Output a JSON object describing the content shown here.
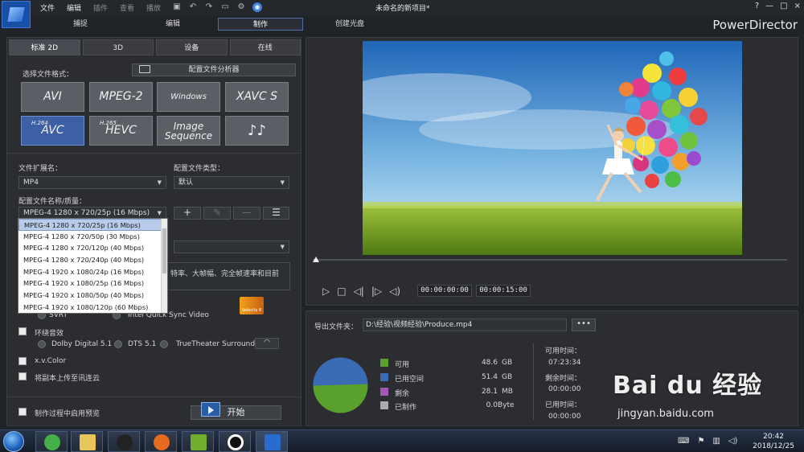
{
  "menu": {
    "items": [
      "文件",
      "编辑",
      "插件",
      "查看",
      "播放"
    ]
  },
  "title": "未命名的新项目*",
  "window_controls": [
    "?",
    "—",
    "□",
    "×"
  ],
  "modes": {
    "capture": "捕捉",
    "edit": "编辑",
    "produce": "制作",
    "disc": "创建光盘"
  },
  "brand": "PowerDirector",
  "subtabs": [
    "标准 2D",
    "3D",
    "设备",
    "在线"
  ],
  "format": {
    "label": "选择文件格式：",
    "analyzer": "配置文件分析器",
    "buttons": {
      "avi": "AVI",
      "mpeg2": "MPEG-2",
      "wmv": "Windows Media",
      "xavcs": "XAVC S",
      "avc_sup": "H.264",
      "avc": "AVC",
      "hevc_sup": "H.265",
      "hevc": "HEVC",
      "imgseq1": "Image",
      "imgseq2": "Sequence",
      "audio": "♪♪"
    }
  },
  "extension": {
    "label": "文件扩展名：",
    "value": "MP4"
  },
  "profile_type": {
    "label": "配置文件类型：",
    "value": "默认"
  },
  "profile": {
    "label": "配置文件名称/质量：",
    "value": "MPEG-4 1280 x 720/25p (16 Mbps)",
    "add": "+",
    "edit": "✎",
    "remove": "—",
    "details": "☰",
    "options": [
      "MPEG-4 1280 x 720/25p (16 Mbps)",
      "MPEG-4 1280 x 720/50p (30 Mbps)",
      "MPEG-4 1280 x 720/120p (40 Mbps)",
      "MPEG-4 1280 x 720/240p (40 Mbps)",
      "MPEG-4 1920 x 1080/24p (16 Mbps)",
      "MPEG-4 1920 x 1080/25p (16 Mbps)",
      "MPEG-4 1920 x 1080/50p (40 Mbps)",
      "MPEG-4 1920 x 1080/120p (60 Mbps)"
    ]
  },
  "description": "特率、大帧幅、完全帧速率和目前",
  "encoder": {
    "svrt": "SVRT",
    "qsv": "Intel Quick Sync Video",
    "velocity": "Velocity 8"
  },
  "surround": {
    "label": "环绕音效",
    "dolby": "Dolby Digital 5.1",
    "dts": "DTS 5.1",
    "truetheater": "TrueTheater Surround"
  },
  "xvcolor": "x.v.Color",
  "upload": "将副本上传至讯连云",
  "preview_while": "制作过程中启用预览",
  "start": "开始",
  "timecodes": {
    "current": "00:00:00:00",
    "total": "00:00:15:00"
  },
  "export": {
    "label": "导出文件夹：",
    "path": "D:\\经验\\视频经验\\Produce.mp4",
    "browse": "•••"
  },
  "disk": {
    "available": {
      "label": "可用",
      "value": "48.6",
      "unit": "GB",
      "color": "#5aa02c"
    },
    "used": {
      "label": "已用空间",
      "value": "51.4",
      "unit": "GB",
      "color": "#3a6bb5"
    },
    "remaining": {
      "label": "剩余",
      "value": "28.1",
      "unit": "MB",
      "color": "#a855b8"
    },
    "produced": {
      "label": "已制作",
      "value": "0.0",
      "unit": "Byte",
      "color": "#aaaaaa"
    }
  },
  "times": {
    "available_label": "可用时间：",
    "available": "07:23:34",
    "remaining_label": "剩余时间：",
    "remaining": "00:00:00",
    "used_label": "已用时间：",
    "used": "00:00:00"
  },
  "clock": {
    "time": "20:42",
    "date": "2018/12/25"
  },
  "watermark": {
    "brand": "Bai du 经验",
    "url": "jingyan.baidu.com"
  }
}
